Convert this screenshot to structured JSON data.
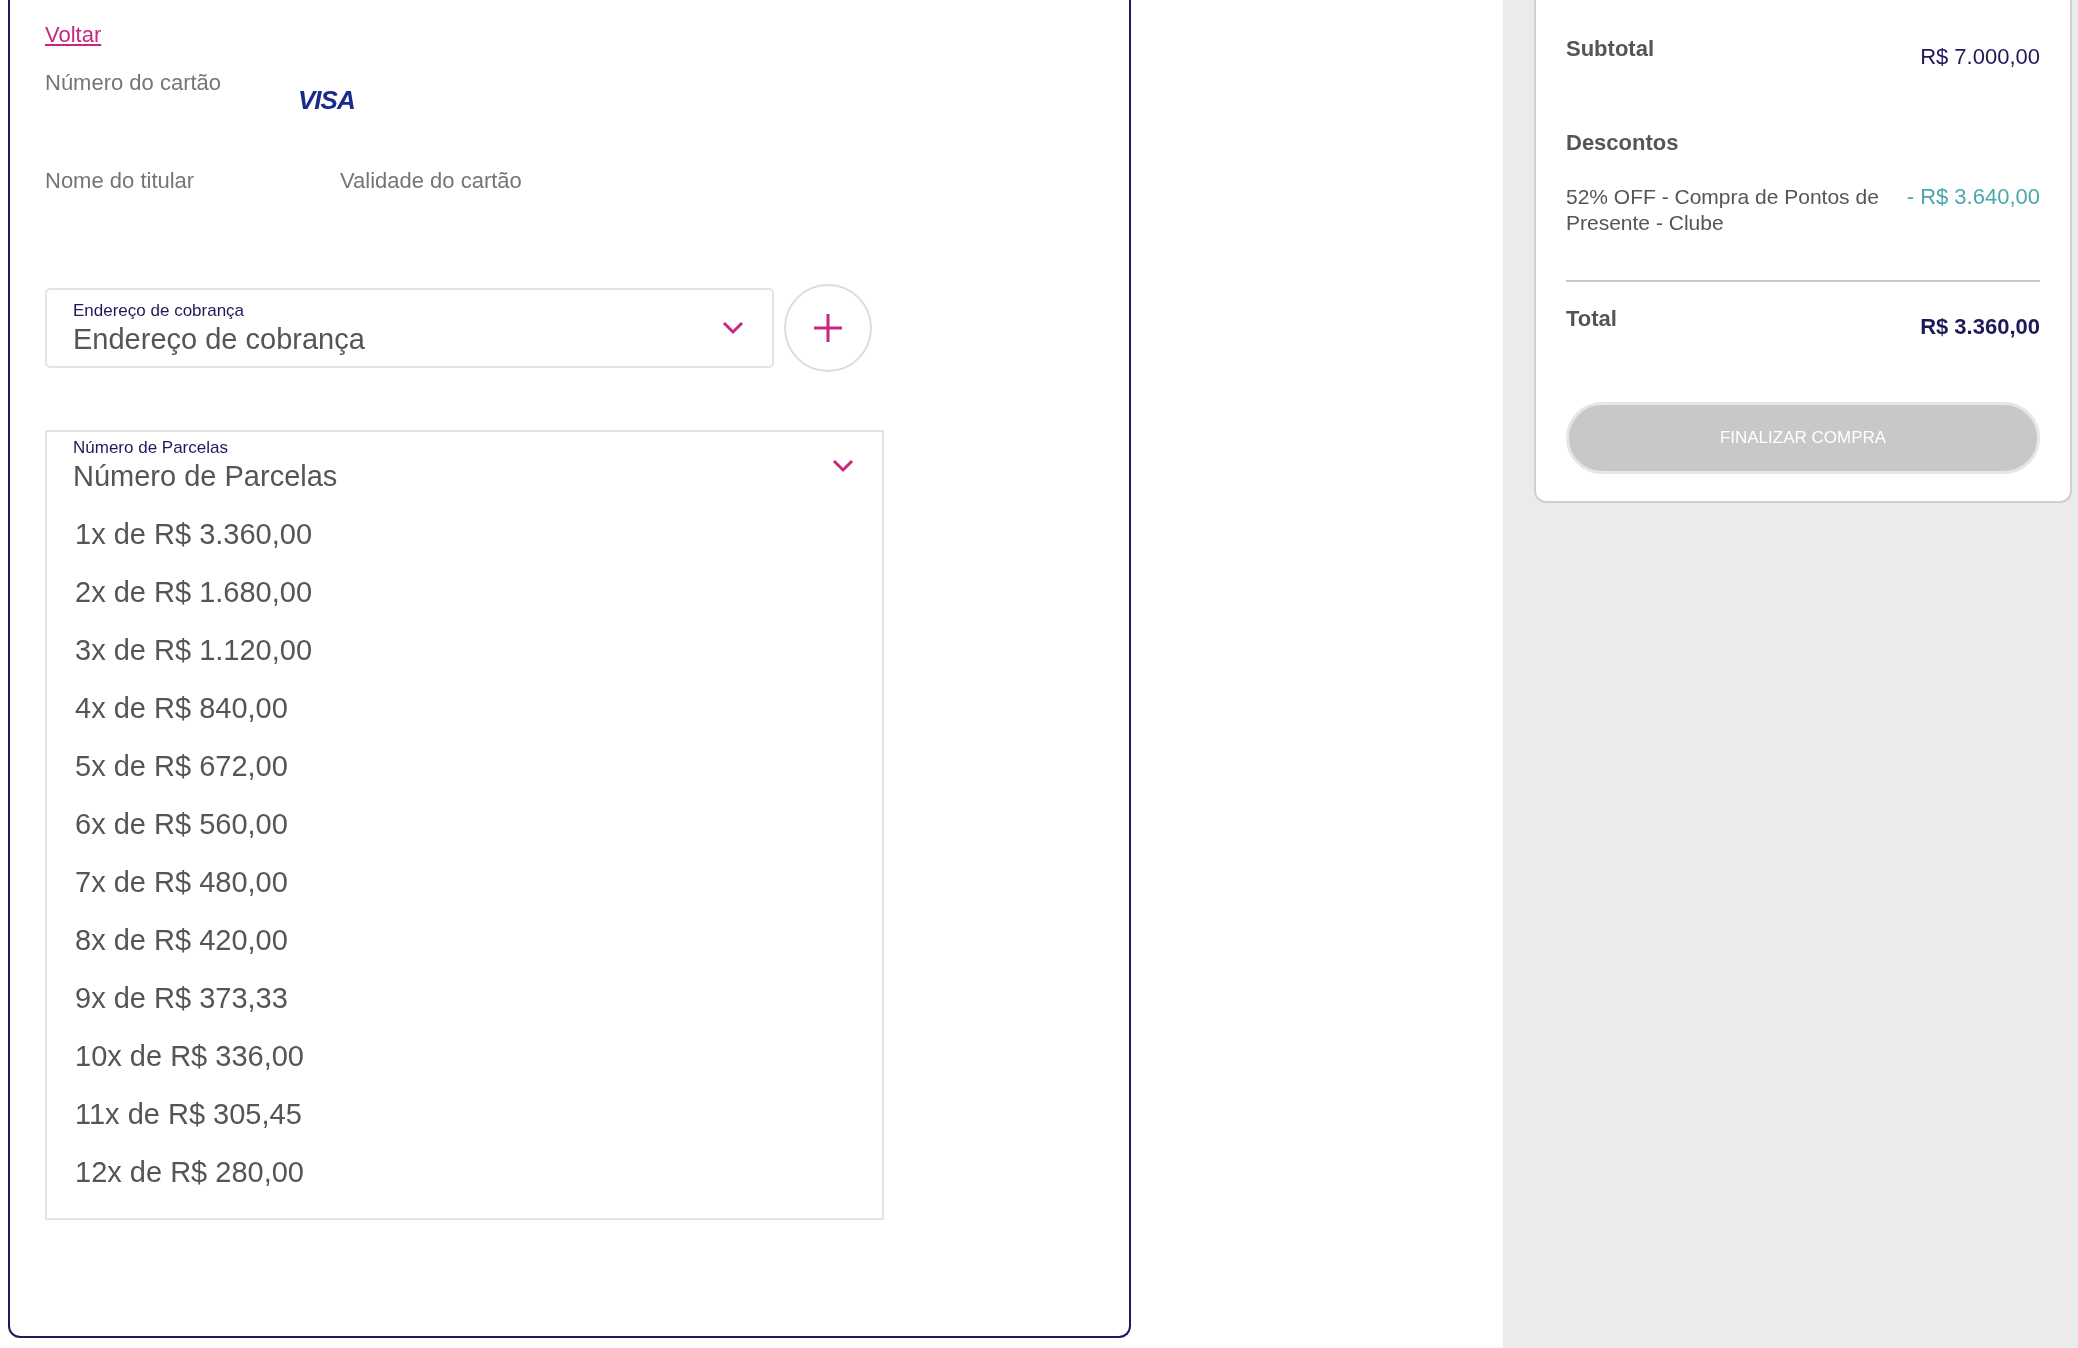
{
  "back_link": "Voltar",
  "card_form": {
    "card_number_label": "Número do cartão",
    "card_brand": "VISA",
    "holder_label": "Nome do titular",
    "expiry_label": "Validade do cartão"
  },
  "billing_address": {
    "label": "Endereço de cobrança",
    "placeholder": "Endereço de cobrança"
  },
  "installments": {
    "label": "Número de Parcelas",
    "placeholder": "Número de Parcelas",
    "expanded": true,
    "options": [
      {
        "text": "1x de R$ 3.360,00",
        "selected": false
      },
      {
        "text": "2x de R$ 1.680,00",
        "selected": false
      },
      {
        "text": "3x de R$ 1.120,00",
        "selected": false
      },
      {
        "text": "4x de R$ 840,00",
        "selected": false
      },
      {
        "text": "5x de R$ 672,00",
        "selected": false
      },
      {
        "text": "6x de R$ 560,00",
        "selected": false
      },
      {
        "text": "7x de R$ 480,00",
        "selected": false
      },
      {
        "text": "8x de R$ 420,00",
        "selected": false
      },
      {
        "text": "9x de R$ 373,33",
        "selected": false
      },
      {
        "text": "10x de R$ 336,00",
        "selected": false
      },
      {
        "text": "11x de R$ 305,45",
        "selected": false
      },
      {
        "text": "12x de R$ 280,00",
        "selected": false
      }
    ]
  },
  "summary": {
    "subtotal_label": "Subtotal",
    "subtotal_value": "R$ 7.000,00",
    "discounts_title": "Descontos",
    "discounts": [
      {
        "description": "52% OFF - Compra de Pontos de Presente - Clube",
        "amount": "- R$ 3.640,00"
      }
    ],
    "total_label": "Total",
    "total_value": "R$ 3.360,00",
    "checkout_button": {
      "label": "FINALIZAR COMPRA",
      "disabled": true
    }
  }
}
